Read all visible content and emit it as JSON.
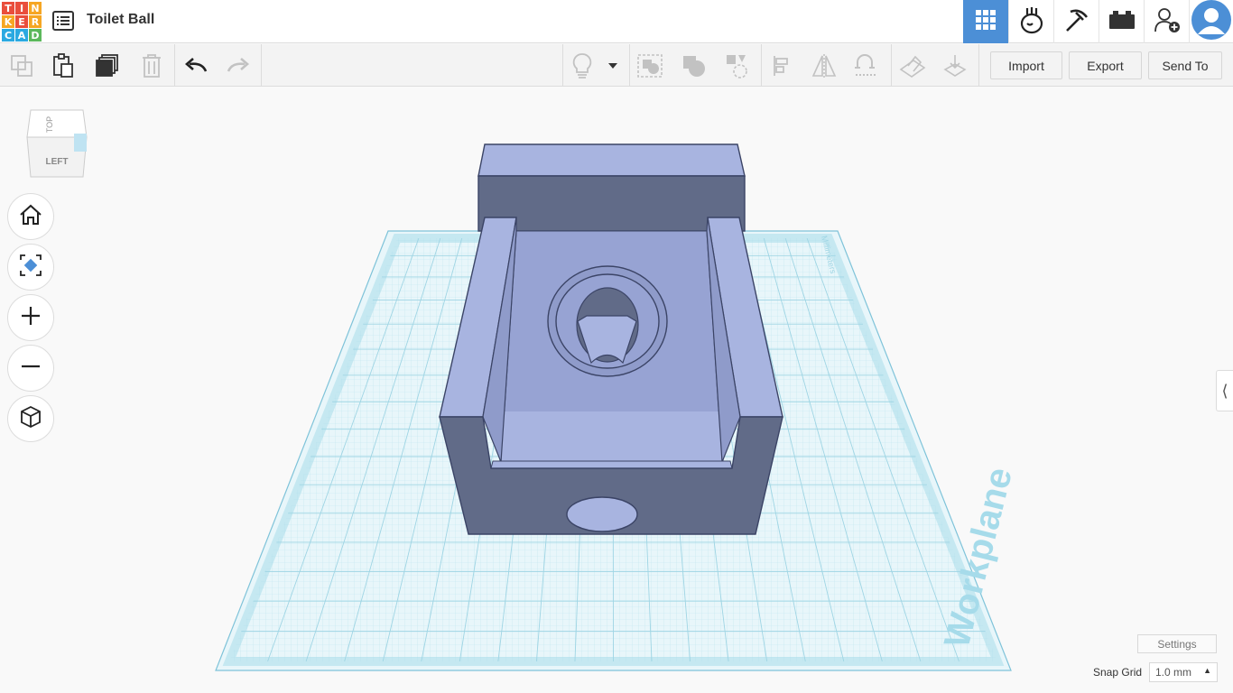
{
  "app": {
    "logo_letters": [
      "T",
      "I",
      "N",
      "K",
      "E",
      "R",
      "C",
      "A",
      "D"
    ],
    "logo_colors": [
      "#e94e3c",
      "#e94e3c",
      "#f6a623",
      "#f6a623",
      "#e94e3c",
      "#f6a623",
      "#2ba9e1",
      "#2ba9e1",
      "#5cb85c"
    ],
    "design_title": "Toilet Ball"
  },
  "header": {
    "menu_icon": "list-icon",
    "tabs": [
      {
        "name": "3d-design-tab",
        "icon": "grid-icon",
        "active": true
      },
      {
        "name": "circuits-tab",
        "icon": "circuits-icon",
        "active": false
      },
      {
        "name": "codeblocks-tab",
        "icon": "pickaxe-icon",
        "active": false
      },
      {
        "name": "bricks-tab",
        "icon": "brick-icon",
        "active": false
      }
    ],
    "invite_icon": "add-user-icon",
    "avatar_icon": "user-avatar-icon",
    "accent_color": "#4c8fd6"
  },
  "toolbar": {
    "left_tools": [
      "copy-icon",
      "paste-icon",
      "duplicate-icon",
      "delete-icon",
      "undo-icon",
      "redo-icon"
    ],
    "right_tools": [
      "light-bulb-icon",
      "dropdown-icon",
      "group-icon",
      "ungroup-icon",
      "hole-icon",
      "align-icon",
      "mirror-icon",
      "cruise-icon",
      "workplane-icon",
      "drop-icon"
    ],
    "import_label": "Import",
    "export_label": "Export",
    "send_to_label": "Send To"
  },
  "view_cube": {
    "top_label": "TOP",
    "left_label": "LEFT"
  },
  "nav": [
    "home-icon",
    "fit-view-icon",
    "zoom-in-icon",
    "zoom-out-icon",
    "perspective-icon"
  ],
  "workplane": {
    "label": "Workplane",
    "units_label": "Millimeters",
    "grid_color": "#7fd0e6",
    "plane_color": "#e8f6fa"
  },
  "model": {
    "body_color": "#a8b4e0",
    "dark_color": "#616b88",
    "mid_color": "#8f9bca"
  },
  "footer": {
    "settings_label": "Settings",
    "snap_grid_label": "Snap Grid",
    "snap_grid_value": "1.0 mm"
  }
}
